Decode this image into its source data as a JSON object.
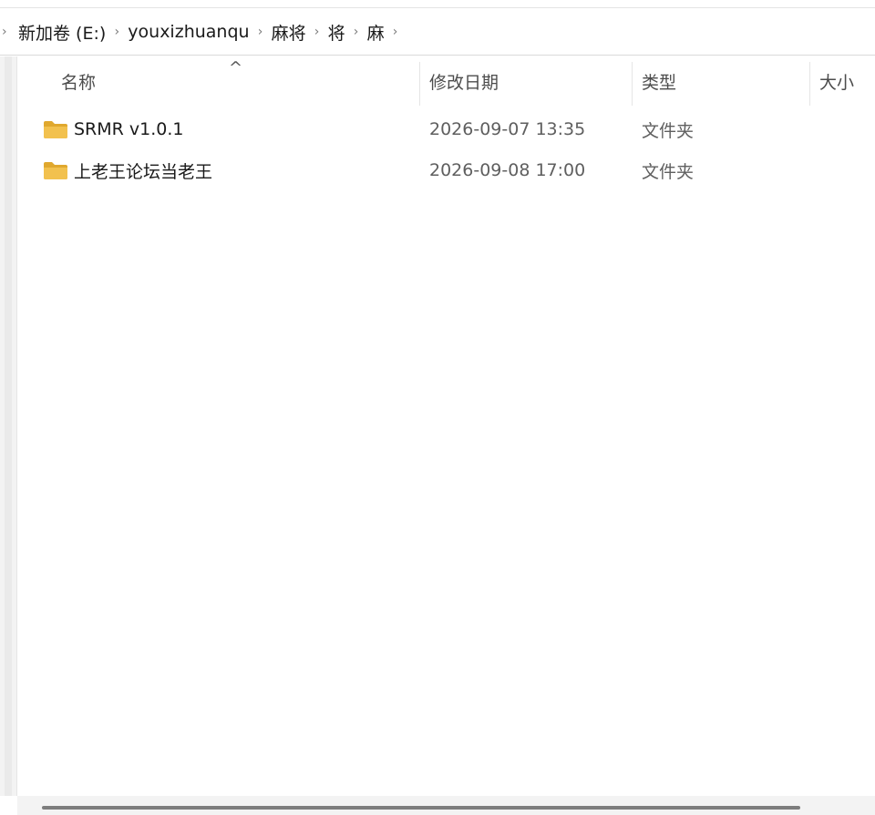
{
  "breadcrumb": {
    "items": [
      "新加卷 (E:)",
      "youxizhuanqu",
      "麻将",
      "将",
      "麻"
    ]
  },
  "columns": {
    "name": "名称",
    "modified": "修改日期",
    "type": "类型",
    "size": "大小"
  },
  "files": [
    {
      "name": "SRMR v1.0.1",
      "modified": "2026-09-07 13:35",
      "type": "文件夹",
      "icon": "folder-icon"
    },
    {
      "name": "上老王论坛当老王",
      "modified": "2026-09-08 17:00",
      "type": "文件夹",
      "icon": "folder-icon"
    }
  ],
  "colors": {
    "folder": "#f2c14e",
    "folder_dark": "#e0a82e"
  }
}
